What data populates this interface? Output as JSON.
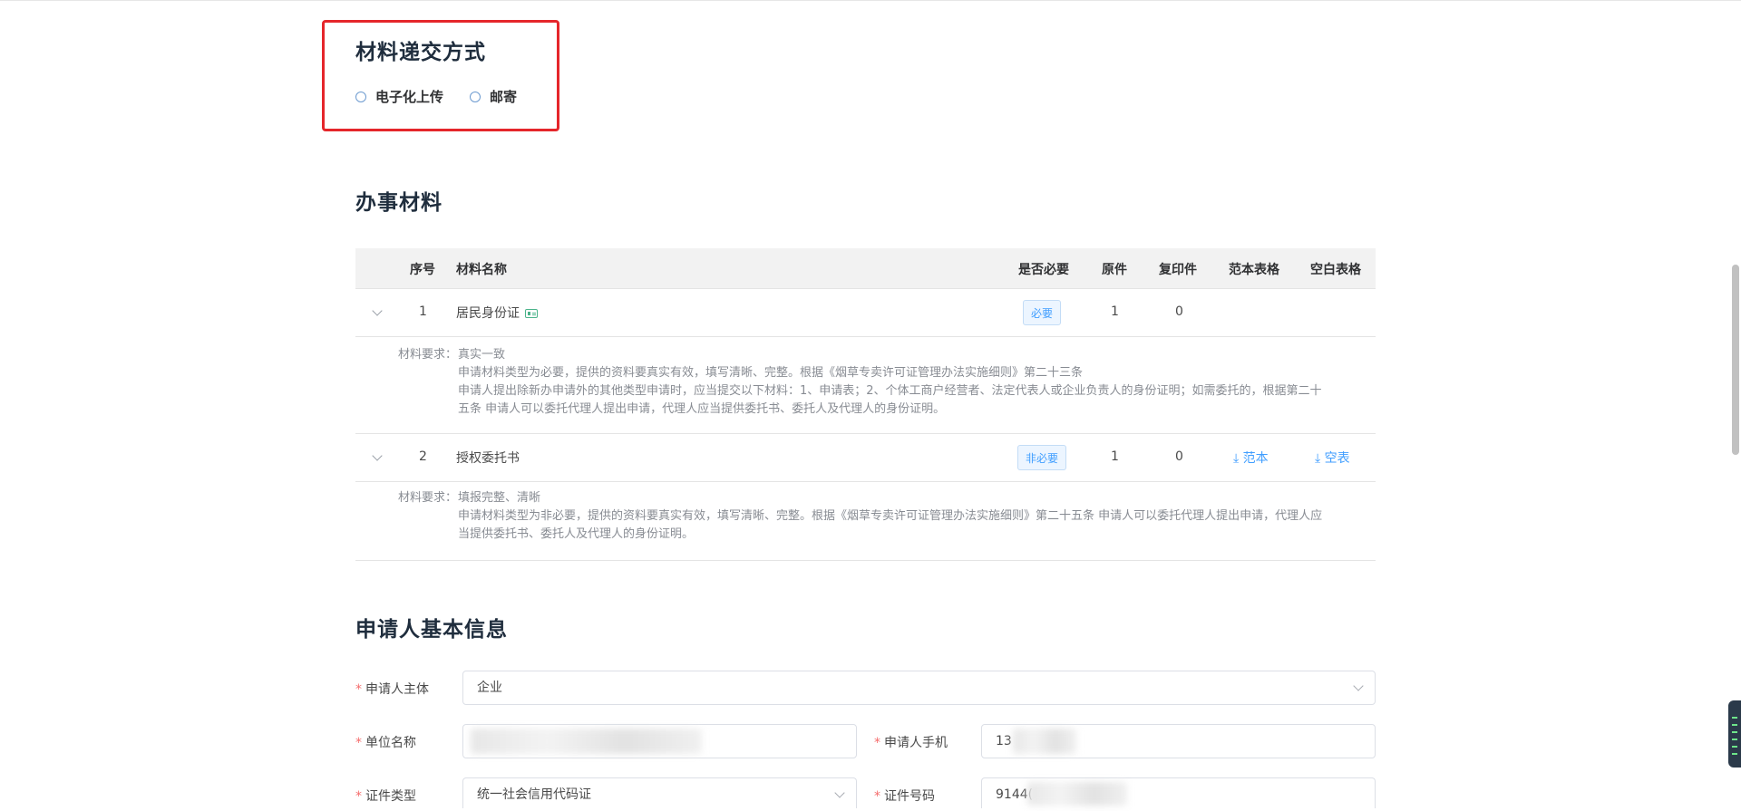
{
  "delivery": {
    "title": "材料递交方式",
    "options": [
      {
        "label": "电子化上传",
        "selected": false
      },
      {
        "label": "邮寄",
        "selected": false
      }
    ]
  },
  "materials": {
    "title": "办事材料",
    "columns": {
      "index": "序号",
      "name": "材料名称",
      "required": "是否必要",
      "original": "原件",
      "copy": "复印件",
      "sample": "范本表格",
      "blank": "空白表格"
    },
    "rows": [
      {
        "index": "1",
        "name": "居民身份证",
        "required": "必要",
        "original": "1",
        "copy": "0",
        "sample": "",
        "blank": "",
        "req_label": "材料要求：",
        "req_lines": [
          "真实一致",
          "申请材料类型为必要，提供的资料要真实有效，填写清晰、完整。根据《烟草专卖许可证管理办法实施细则》第二十三条",
          "申请人提出除新办申请外的其他类型申请时，应当提交以下材料：1、申请表；2、个体工商户经营者、法定代表人或企业负责人的身份证明；如需委托的，根据第二十",
          "五条 申请人可以委托代理人提出申请，代理人应当提供委托书、委托人及代理人的身份证明。"
        ]
      },
      {
        "index": "2",
        "name": "授权委托书",
        "required": "非必要",
        "original": "1",
        "copy": "0",
        "sample": "范本",
        "blank": "空表",
        "req_label": "材料要求：",
        "req_lines": [
          "填报完整、清晰",
          "申请材料类型为非必要，提供的资料要真实有效，填写清晰、完整。根据《烟草专卖许可证管理办法实施细则》第二十五条 申请人可以委托代理人提出申请，代理人应",
          "当提供委托书、委托人及代理人的身份证明。"
        ]
      }
    ]
  },
  "applicant": {
    "title": "申请人基本信息",
    "required_mark": "*",
    "subject_label": "申请人主体",
    "subject_value": "企业",
    "company_label": "单位名称",
    "company_value": "",
    "phone_label": "申请人手机",
    "phone_value": "13",
    "id_type_label": "证件类型",
    "id_type_value": "统一社会信用代码证",
    "id_no_label": "证件号码",
    "id_no_value": "9144("
  },
  "colors": {
    "accent": "#409eff",
    "required": "#f56c6c",
    "highlight_border": "#e5262b"
  }
}
